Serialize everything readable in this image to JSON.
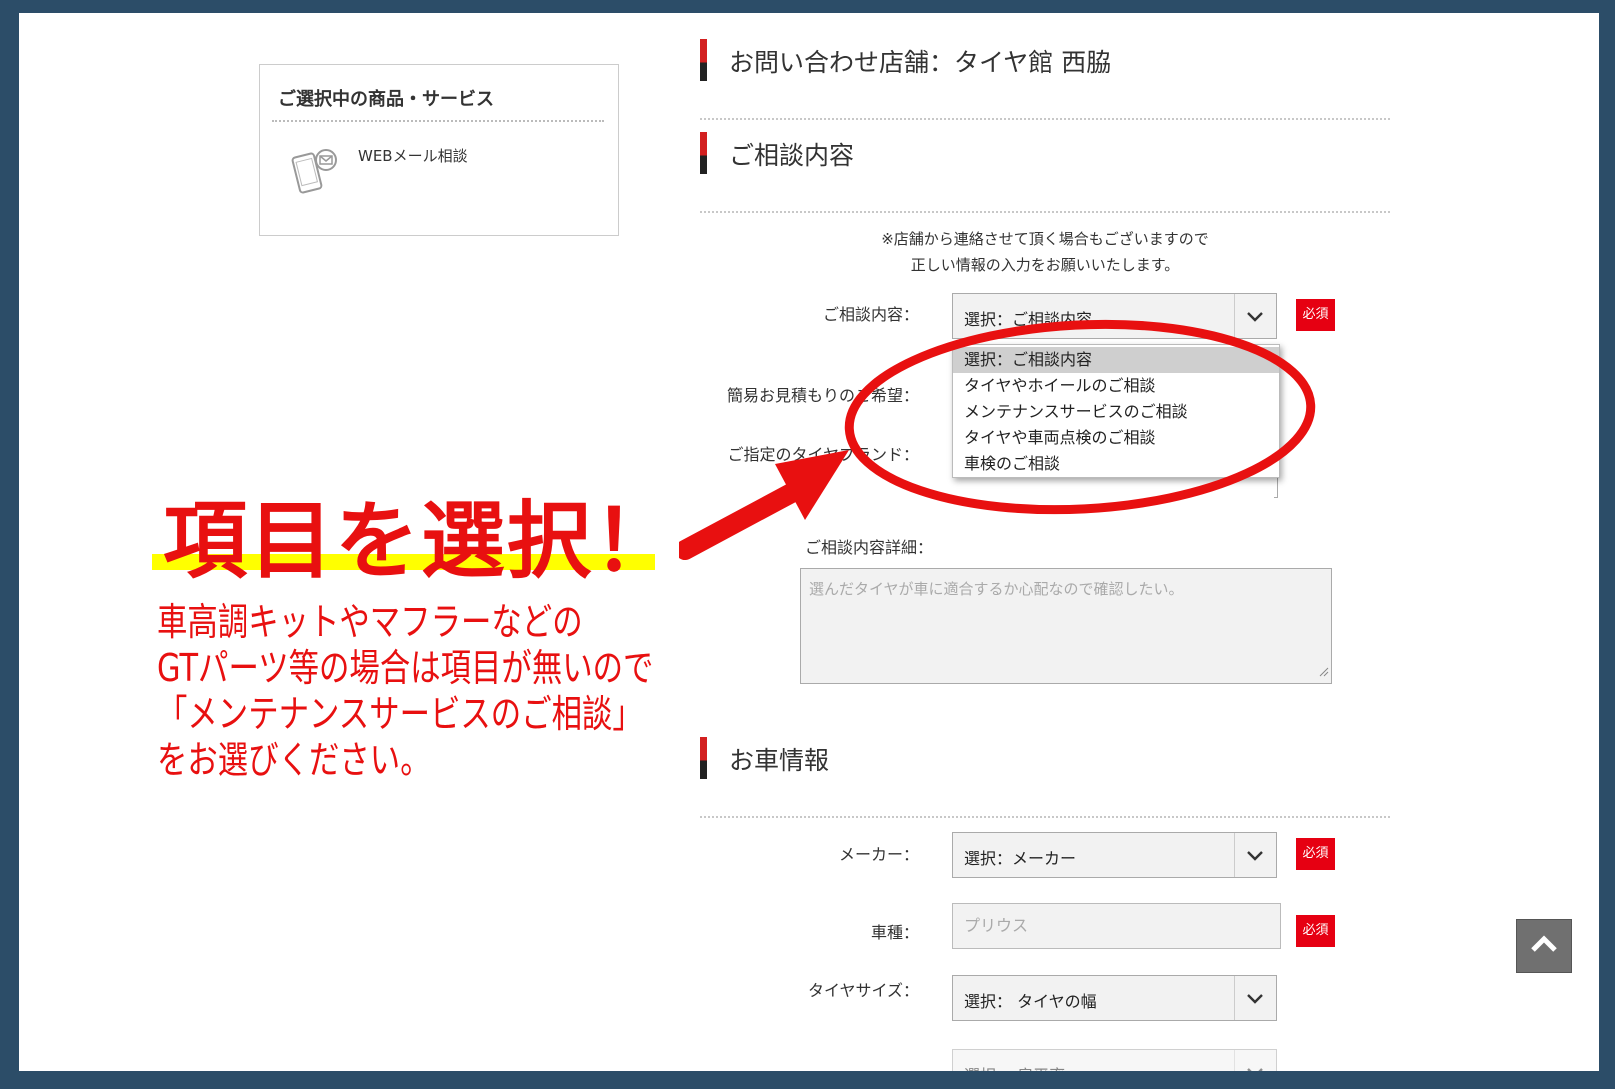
{
  "colors": {
    "frame": "#2c4d68",
    "accent_red": "#e60012",
    "annotation_red": "#e81010",
    "highlight": "#ffff00"
  },
  "product_box": {
    "title": "ご選択中の商品・サービス",
    "item_name": "WEBメール相談",
    "item_icon": "phone-mail-icon"
  },
  "store": {
    "heading": "お問い合わせ店舗：タイヤ館 西脇"
  },
  "consultation": {
    "heading": "ご相談内容",
    "notice_line1": "※店舗から連絡させて頂く場合もございますので",
    "notice_line2": "正しい情報の入力をお願いいたします。",
    "content_label": "ご相談内容：",
    "content_value": "選択：ご相談内容",
    "required_label": "必須",
    "estimate_label": "簡易お見積もりのご希望：",
    "brand_label": "ご指定のタイヤブランド：",
    "dropdown_options": [
      "選択：ご相談内容",
      "タイヤやホイールのご相談",
      "メンテナンスサービスのご相談",
      "タイヤや車両点検のご相談",
      "車検のご相談"
    ],
    "selected_option_index": 0,
    "detail_label": "ご相談内容詳細：",
    "detail_placeholder": "選んだタイヤが車に適合するか心配なので確認したい。"
  },
  "car_info": {
    "heading": "お車情報",
    "maker_label": "メーカー：",
    "maker_value": "選択：メーカー",
    "model_label": "車種：",
    "model_placeholder": "プリウス",
    "tire_size_label": "タイヤサイズ：",
    "tire_width_value": "選択： タイヤの幅",
    "aspect_value": "選択： 扁平率",
    "required_label": "必須"
  },
  "annotation": {
    "title": "項目を選択！",
    "line1": "車高調キットやマフラーなどの",
    "line2": "GTパーツ等の場合は項目が無いので",
    "line3": "「メンテナンスサービスのご相談」",
    "line4": "をお選びください。"
  },
  "scroll_top_icon": "chevron-up-icon"
}
